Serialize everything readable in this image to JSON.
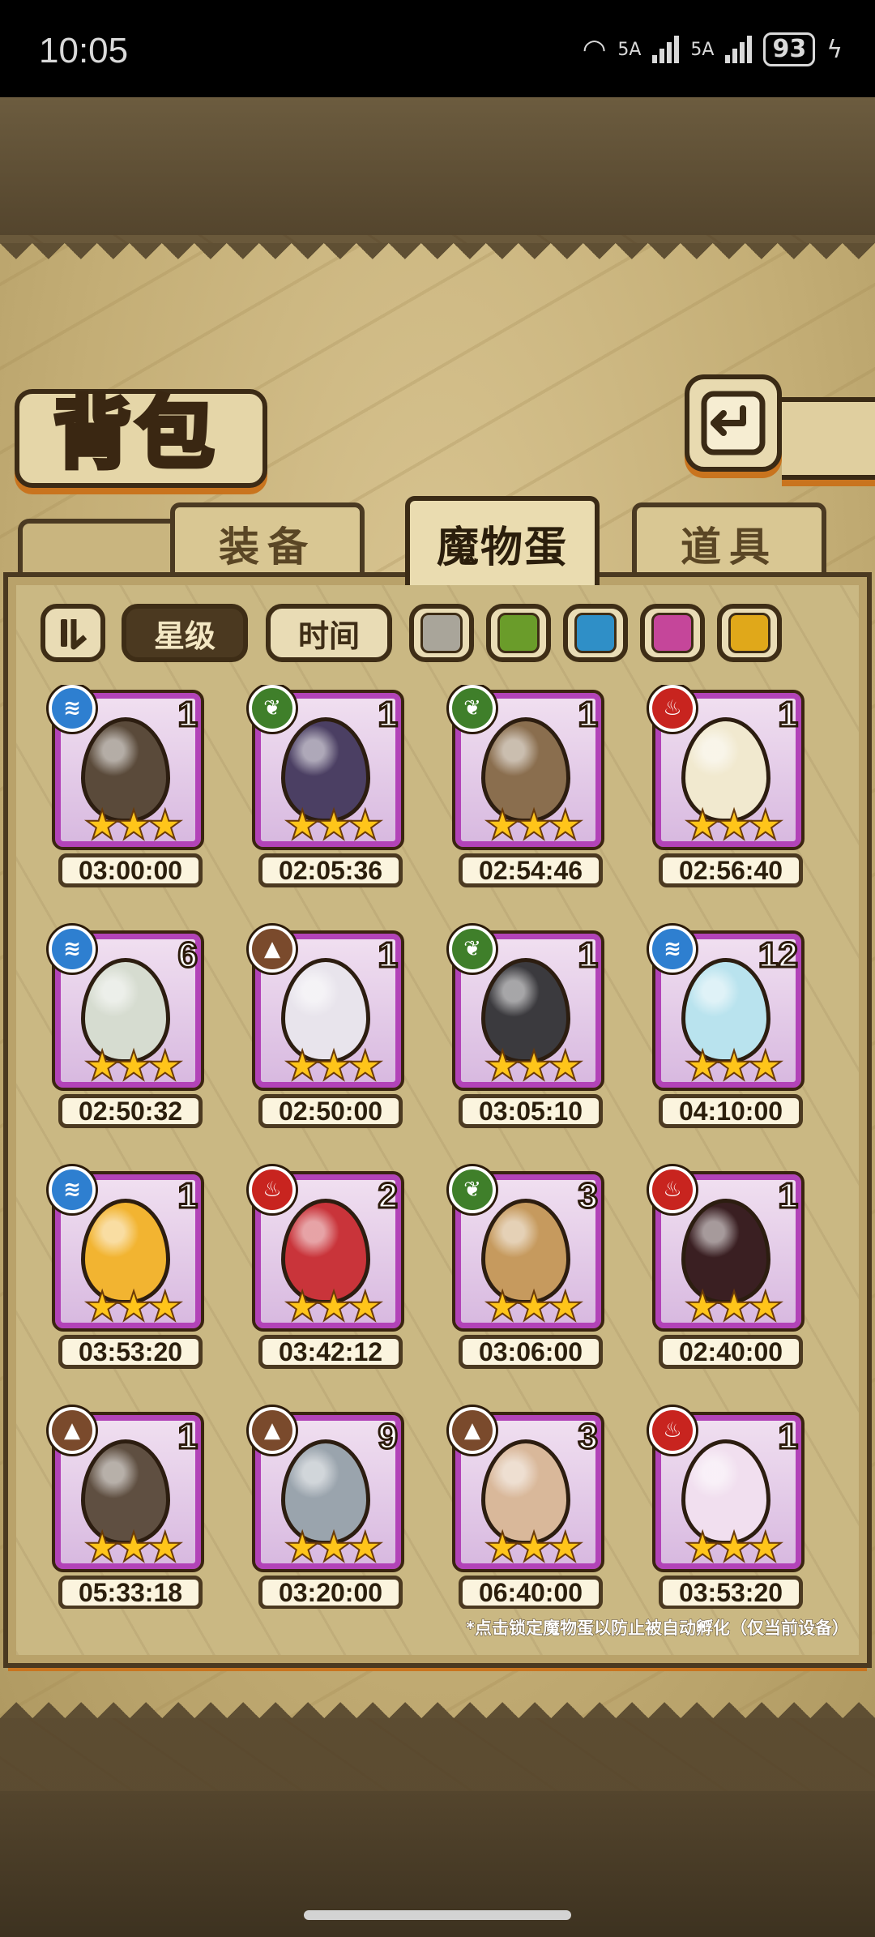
{
  "status_bar": {
    "time": "10:05",
    "network_1": "5A",
    "network_2": "5A",
    "battery": "93"
  },
  "header": {
    "title": "背包"
  },
  "tabs": [
    {
      "label": "装备",
      "selected": false
    },
    {
      "label": "魔物蛋",
      "selected": true
    },
    {
      "label": "道具",
      "selected": false
    }
  ],
  "filters": {
    "star_label": "星级",
    "time_label": "时间",
    "active_sort": "星级",
    "color_swatches": [
      "#a9a59a",
      "#6a9c2a",
      "#2f8fc7",
      "#c5469a",
      "#e0a81a"
    ]
  },
  "elements": {
    "water": {
      "icon": "water-wave-icon",
      "color": "#2e7fd0",
      "glyph": "≋"
    },
    "grass": {
      "icon": "leaf-icon",
      "color": "#3f7f2a",
      "glyph": "❦"
    },
    "fire": {
      "icon": "flame-icon",
      "color": "#c8241f",
      "glyph": "♨"
    },
    "earth": {
      "icon": "mountain-icon",
      "color": "#7a4a2c",
      "glyph": "▲"
    }
  },
  "eggs": [
    {
      "element": "water",
      "count": "1",
      "stars": 3,
      "timer": "03:00:00",
      "egg_color": "#5a4a3a"
    },
    {
      "element": "grass",
      "count": "1",
      "stars": 3,
      "timer": "02:05:36",
      "egg_color": "#4b3f63"
    },
    {
      "element": "grass",
      "count": "1",
      "stars": 3,
      "timer": "02:54:46",
      "egg_color": "#8a6e4e"
    },
    {
      "element": "fire",
      "count": "1",
      "stars": 3,
      "timer": "02:56:40",
      "egg_color": "#f1e9cf"
    },
    {
      "element": "water",
      "count": "6",
      "stars": 3,
      "timer": "02:50:32",
      "egg_color": "#d6dcd0"
    },
    {
      "element": "earth",
      "count": "1",
      "stars": 3,
      "timer": "02:50:00",
      "egg_color": "#e8e4ec"
    },
    {
      "element": "grass",
      "count": "1",
      "stars": 3,
      "timer": "03:05:10",
      "egg_color": "#3b3a3e"
    },
    {
      "element": "water",
      "count": "12",
      "stars": 3,
      "timer": "04:10:00",
      "egg_color": "#b9e3ee"
    },
    {
      "element": "water",
      "count": "1",
      "stars": 3,
      "timer": "03:53:20",
      "egg_color": "#f2b431"
    },
    {
      "element": "fire",
      "count": "2",
      "stars": 3,
      "timer": "03:42:12",
      "egg_color": "#c9343a"
    },
    {
      "element": "grass",
      "count": "3",
      "stars": 3,
      "timer": "03:06:00",
      "egg_color": "#c69a5e"
    },
    {
      "element": "fire",
      "count": "1",
      "stars": 3,
      "timer": "02:40:00",
      "egg_color": "#3a1f22"
    },
    {
      "element": "earth",
      "count": "1",
      "stars": 3,
      "timer": "05:33:18",
      "egg_color": "#5f4f41"
    },
    {
      "element": "earth",
      "count": "9",
      "stars": 3,
      "timer": "03:20:00",
      "egg_color": "#9aa4ad"
    },
    {
      "element": "earth",
      "count": "3",
      "stars": 3,
      "timer": "06:40:00",
      "egg_color": "#d9b89a"
    },
    {
      "element": "fire",
      "count": "1",
      "stars": 3,
      "timer": "03:53:20",
      "egg_color": "#f1dfef"
    }
  ],
  "footnote": "*点击锁定魔物蛋以防止被自动孵化（仅当前设备）"
}
